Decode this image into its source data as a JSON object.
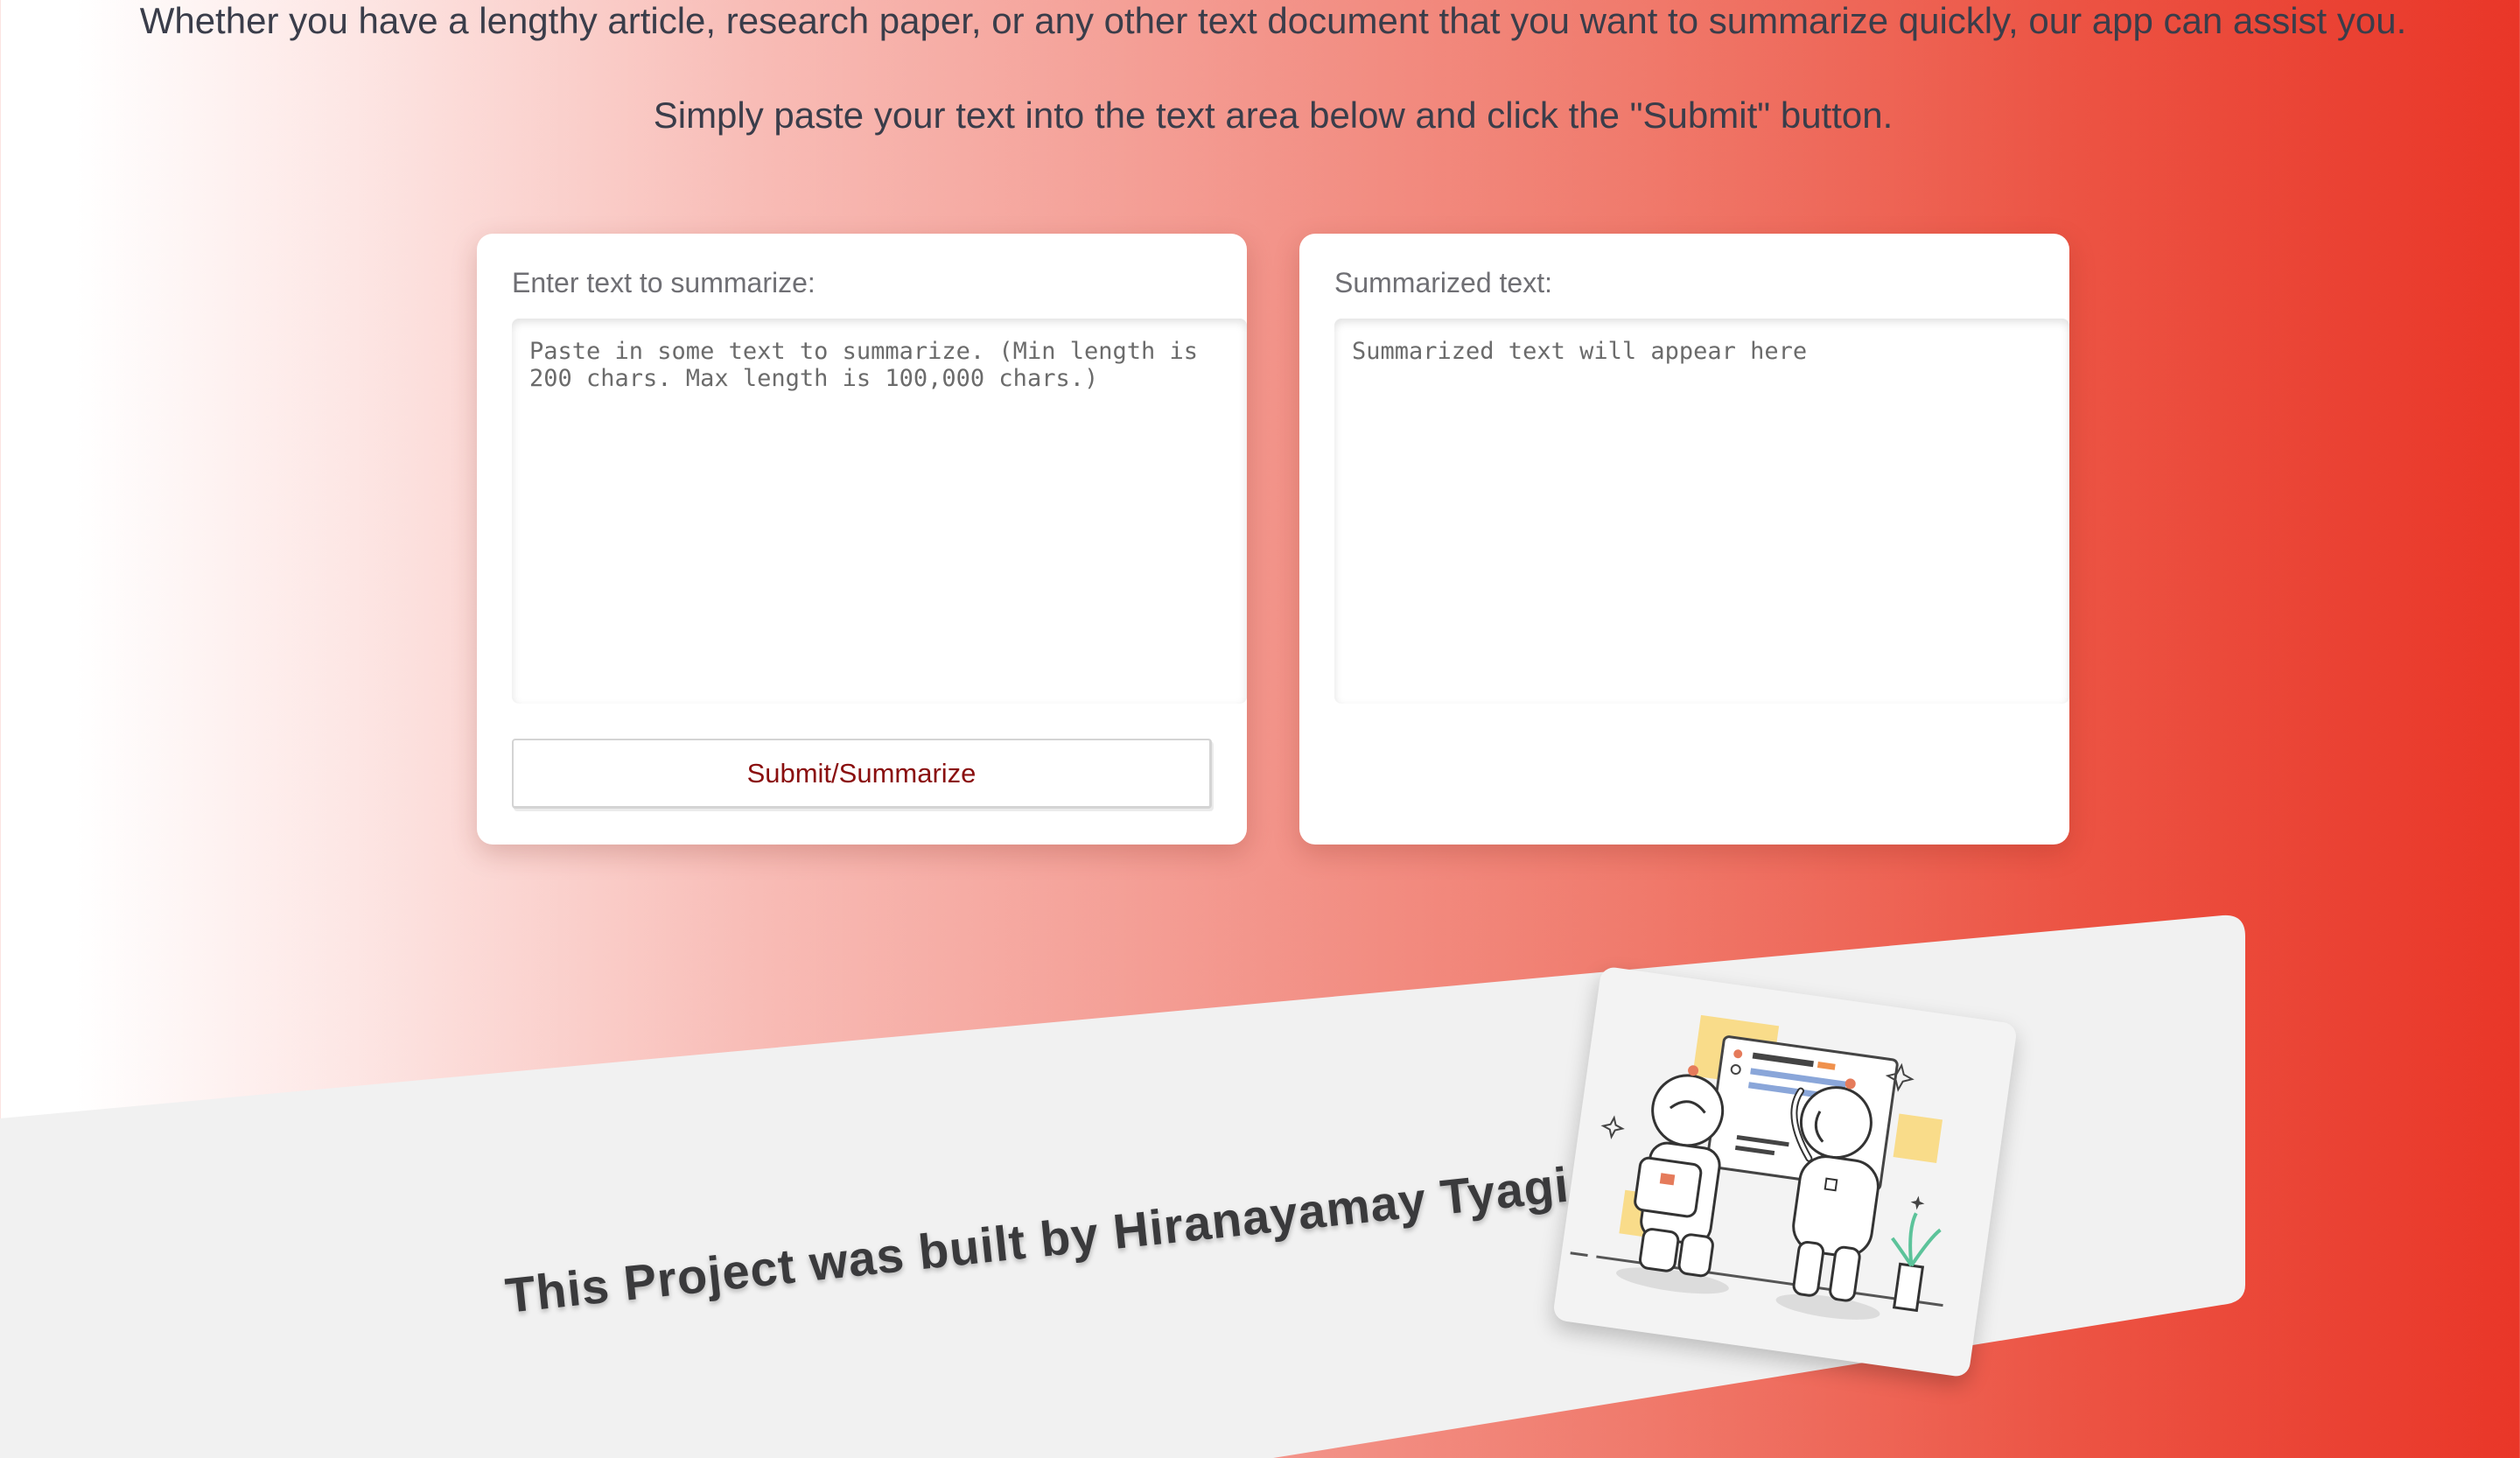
{
  "intro": {
    "line1": "Whether you have a lengthy article, research paper, or any other text document that you want to summarize quickly, our app can assist you.",
    "line2": "Simply paste your text into the text area below and click the \"Submit\" button."
  },
  "input_panel": {
    "label": "Enter text to summarize:",
    "placeholder": "Paste in some text to summarize. (Min length is 200 chars. Max length is 100,000 chars.)",
    "value": "",
    "submit_label": "Submit/Summarize"
  },
  "output_panel": {
    "label": "Summarized text:",
    "placeholder": "Summarized text will appear here",
    "value": ""
  },
  "footer": {
    "credit": "This Project was built by Hiranayamay Tyagi",
    "illustration_icon": "astronauts-at-whiteboard-illustration"
  },
  "colors": {
    "gradient_start": "#ffffff",
    "gradient_end": "#e93628",
    "button_text": "#8a0f0f",
    "footer_band": "#f1f1f1"
  }
}
